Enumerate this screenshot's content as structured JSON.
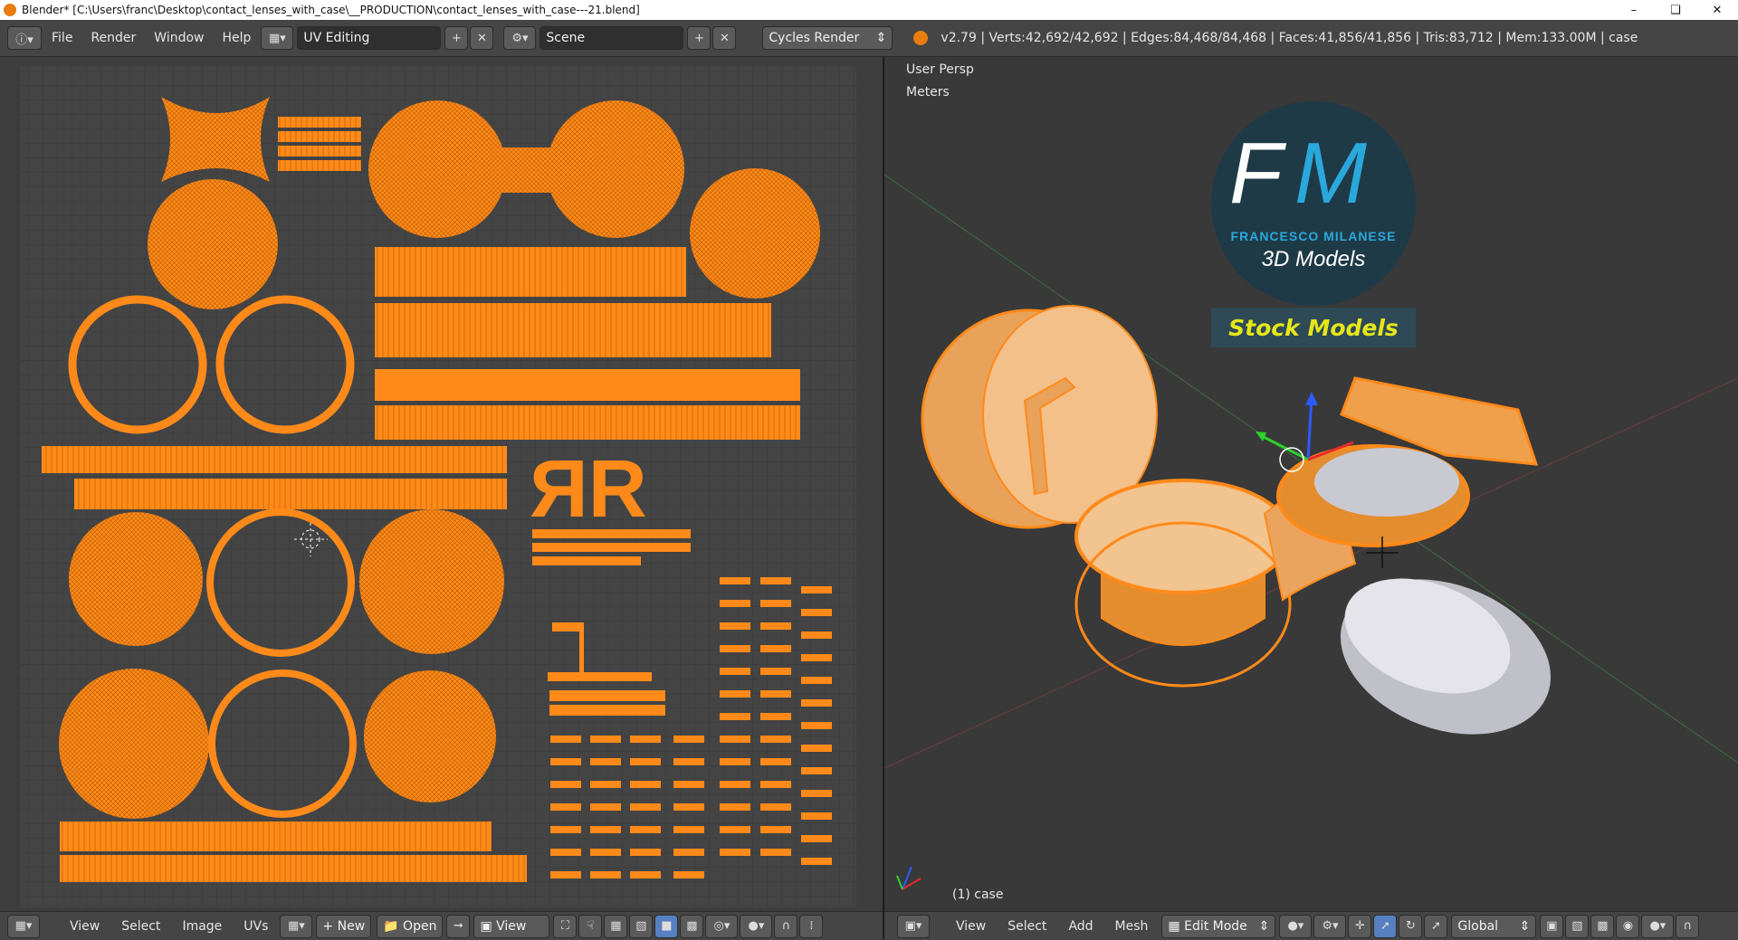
{
  "titlebar": {
    "title": "Blender* [C:\\Users\\franc\\Desktop\\contact_lenses_with_case\\__PRODUCTION\\contact_lenses_with_case---21.blend]",
    "minimize_icon": "minimize-icon",
    "restore_icon": "restore-icon",
    "close_icon": "close-icon"
  },
  "infobar": {
    "menus": [
      "File",
      "Render",
      "Window",
      "Help"
    ],
    "screen_layout": "UV Editing",
    "scene": "Scene",
    "render_engine": "Cycles Render",
    "stats": "v2.79 | Verts:42,692/42,692 | Edges:84,468/84,468 | Faces:41,856/41,856 | Tris:83,712 | Mem:133.00M | case"
  },
  "uv_editor": {
    "menus": [
      "View",
      "Select",
      "Image",
      "UVs"
    ],
    "new_label": "New",
    "open_label": "Open",
    "view_label": "View"
  },
  "viewport": {
    "view_name": "User Persp",
    "units": "Meters",
    "object_label": "(1) case",
    "menus": [
      "View",
      "Select",
      "Add",
      "Mesh"
    ],
    "mode": "Edit Mode",
    "orientation": "Global"
  },
  "logo": {
    "letters_f": "F",
    "letters_m": "M",
    "brand": "FRANCESCO MILANESE",
    "tagline": "3D Models",
    "stock": "Stock Models"
  },
  "colors": {
    "uv_orange": "#ff8a1a",
    "panel_bg": "#3d3d3d",
    "header_bg": "#454545",
    "logo_blue": "#2aa8dc"
  }
}
